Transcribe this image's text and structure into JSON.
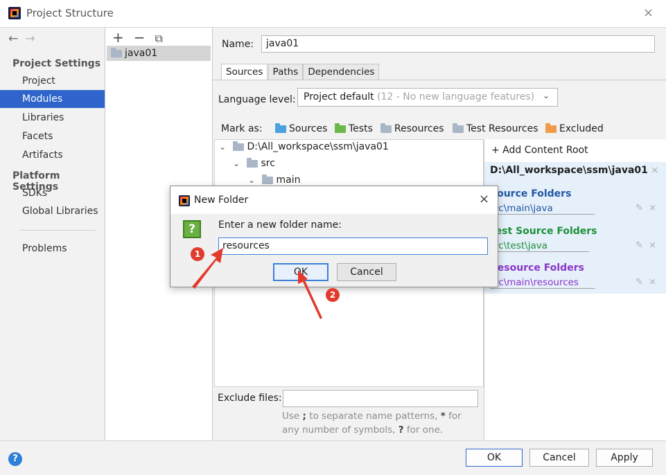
{
  "window": {
    "title": "Project Structure",
    "close": "×"
  },
  "nav": {
    "back": "←",
    "forward": "→",
    "project_settings": "Project Settings",
    "items_top": [
      "Project",
      "Modules",
      "Libraries",
      "Facets",
      "Artifacts"
    ],
    "platform_settings": "Platform Settings",
    "items_platform": [
      "SDKs",
      "Global Libraries"
    ],
    "problems": "Problems",
    "selected": "Modules"
  },
  "modules": {
    "add": "+",
    "remove": "−",
    "copy": "⧉",
    "list": [
      "java01"
    ]
  },
  "main": {
    "name_label": "Name:",
    "name_value": "java01",
    "tabs": [
      "Sources",
      "Paths",
      "Dependencies"
    ],
    "lang_label": "Language level:",
    "lang_value": "Project default",
    "lang_hint": "(12 - No new language features)",
    "mark_as_label": "Mark as:",
    "marks": [
      "Sources",
      "Tests",
      "Resources",
      "Test Resources",
      "Excluded"
    ]
  },
  "tree": {
    "root": "D:\\All_workspace\\ssm\\java01",
    "src": "src",
    "main": "main"
  },
  "roots": {
    "add_label": "+ Add Content Root",
    "root_path": "D:\\All_workspace\\ssm\\java01",
    "source_head": "Source Folders",
    "source_path": "src\\main\\java",
    "test_head": "Test Source Folders",
    "test_path": "src\\test\\java",
    "resource_head": "Resource Folders",
    "resource_path": "src\\main\\resources",
    "colors": {
      "source": "#2157a3",
      "test": "#1d8f3a",
      "resource": "#8a35c9"
    }
  },
  "exclude": {
    "label": "Exclude files:",
    "value": "",
    "hint_1": "Use ",
    "hint_2": ";",
    "hint_3": " to separate name patterns, ",
    "hint_4": "*",
    "hint_5": " for any number of symbols, ",
    "hint_6": "?",
    "hint_7": " for one."
  },
  "bottom": {
    "help": "?",
    "ok": "OK",
    "cancel": "Cancel",
    "apply": "Apply"
  },
  "dialog": {
    "title": "New Folder",
    "close": "×",
    "icon": "?",
    "prompt": "Enter a new folder name:",
    "input_value": "resources",
    "ok": "OK",
    "cancel": "Cancel"
  },
  "annotations": {
    "step1": "1",
    "step2": "2",
    "color": "#e23b2e"
  }
}
